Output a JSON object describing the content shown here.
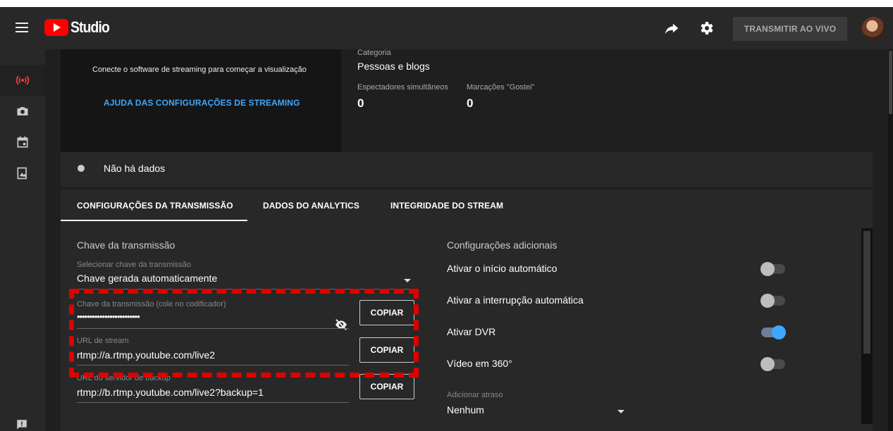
{
  "header": {
    "brand": "Studio",
    "live_button": "TRANSMITIR AO VIVO"
  },
  "sidebar": {
    "items": [
      {
        "icon": "live-broadcast-icon"
      },
      {
        "icon": "camera-icon"
      },
      {
        "icon": "calendar-icon"
      },
      {
        "icon": "manage-icon"
      }
    ],
    "feedback_icon": "feedback-icon"
  },
  "preview": {
    "connect_text": "Conecte o software de streaming para começar a visualização",
    "help_link": "AJUDA DAS CONFIGURAÇÕES DE STREAMING"
  },
  "stats": {
    "category_label": "Categoria",
    "category_value": "Pessoas e blogs",
    "viewers_label": "Espectadores simultâneos",
    "viewers_value": "0",
    "likes_label": "Marcações \"Gostei\"",
    "likes_value": "0"
  },
  "status": {
    "nodata": "Não há dados"
  },
  "tabs": [
    {
      "label": "CONFIGURAÇÕES DA TRANSMISSÃO",
      "active": true
    },
    {
      "label": "DADOS DO ANALYTICS",
      "active": false
    },
    {
      "label": "INTEGRIDADE DO STREAM",
      "active": false
    }
  ],
  "stream": {
    "title": "Chave da transmissão",
    "select_label": "Selecionar chave da transmissão",
    "select_value": "Chave gerada automaticamente",
    "key_label": "Chave da transmissão (cole no codificador)",
    "key_value": "•••••••••••••••••••••••••",
    "url_label": "URL de stream",
    "url_value": "rtmp://a.rtmp.youtube.com/live2",
    "backup_label": "URL do servidor de backup",
    "backup_value": "rtmp://b.rtmp.youtube.com/live2?backup=1",
    "copy_label": "COPIAR"
  },
  "additional": {
    "title": "Configurações adicionais",
    "settings": [
      {
        "label": "Ativar o início automático",
        "on": false
      },
      {
        "label": "Ativar a interrupção automática",
        "on": false
      },
      {
        "label": "Ativar DVR",
        "on": true
      },
      {
        "label": "Vídeo em 360°",
        "on": false
      }
    ],
    "delay_label": "Adicionar atraso",
    "delay_value": "Nenhum"
  },
  "colors": {
    "accent": "#3ea6ff",
    "brand_red": "#ff0000",
    "annotation": "#e00000"
  }
}
